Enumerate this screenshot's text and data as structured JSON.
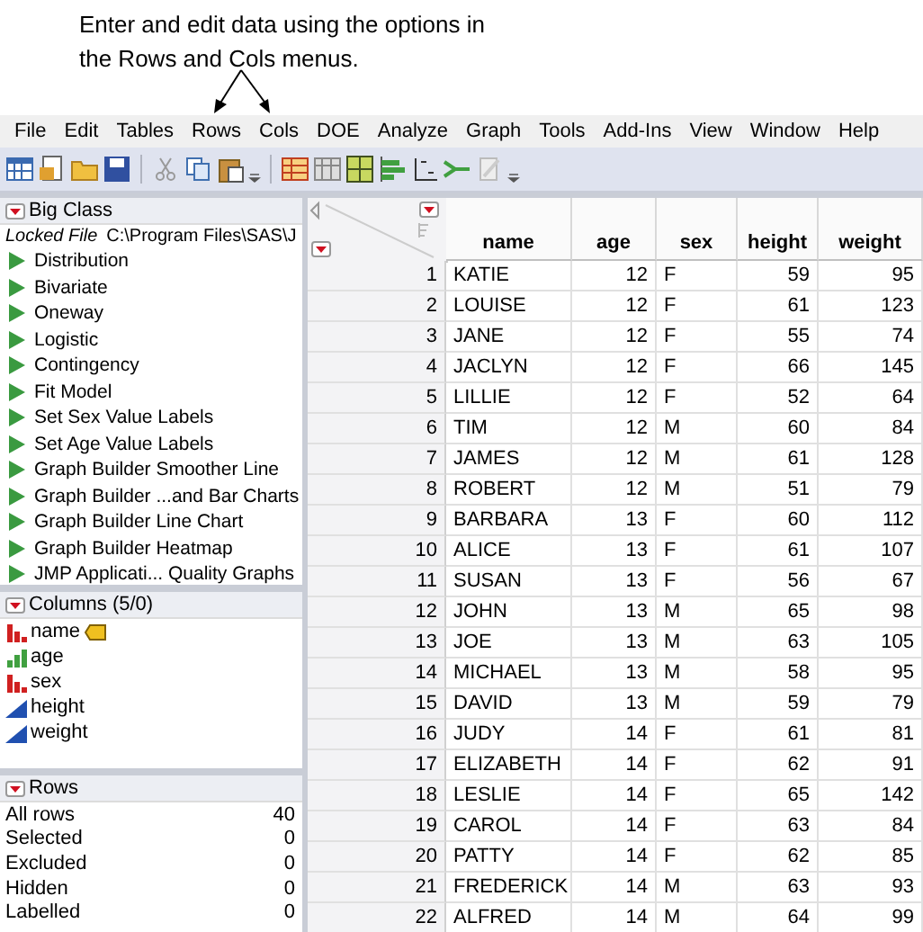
{
  "annotation": "Enter and edit data using the options in the Rows and Cols menus.",
  "menu": [
    "File",
    "Edit",
    "Tables",
    "Rows",
    "Cols",
    "DOE",
    "Analyze",
    "Graph",
    "Tools",
    "Add-Ins",
    "View",
    "Window",
    "Help"
  ],
  "table_panel": {
    "title": "Big Class",
    "locked_label": "Locked File",
    "path": "C:\\Program Files\\SAS\\J",
    "scripts": [
      "Distribution",
      "Bivariate",
      "Oneway",
      "Logistic",
      "Contingency",
      "Fit Model",
      "Set Sex Value Labels",
      "Set Age Value Labels",
      "Graph Builder Smoother Line",
      "Graph Builder ...and Bar Charts",
      "Graph Builder Line Chart",
      "Graph Builder Heatmap",
      "JMP Applicati... Quality Graphs"
    ]
  },
  "columns_panel": {
    "title": "Columns (5/0)",
    "columns": [
      {
        "name": "name",
        "kind": "nominal",
        "label": true
      },
      {
        "name": "age",
        "kind": "ordinal",
        "label": false
      },
      {
        "name": "sex",
        "kind": "nominal",
        "label": false
      },
      {
        "name": "height",
        "kind": "continuous",
        "label": false
      },
      {
        "name": "weight",
        "kind": "continuous",
        "label": false
      }
    ]
  },
  "rows_panel": {
    "title": "Rows",
    "stats": [
      {
        "label": "All rows",
        "value": "40"
      },
      {
        "label": "Selected",
        "value": "0"
      },
      {
        "label": "Excluded",
        "value": "0"
      },
      {
        "label": "Hidden",
        "value": "0"
      },
      {
        "label": "Labelled",
        "value": "0"
      }
    ]
  },
  "table": {
    "columns": [
      "",
      "name",
      "age",
      "sex",
      "height",
      "weight"
    ],
    "rows": [
      [
        "1",
        "KATIE",
        "12",
        "F",
        "59",
        "95"
      ],
      [
        "2",
        "LOUISE",
        "12",
        "F",
        "61",
        "123"
      ],
      [
        "3",
        "JANE",
        "12",
        "F",
        "55",
        "74"
      ],
      [
        "4",
        "JACLYN",
        "12",
        "F",
        "66",
        "145"
      ],
      [
        "5",
        "LILLIE",
        "12",
        "F",
        "52",
        "64"
      ],
      [
        "6",
        "TIM",
        "12",
        "M",
        "60",
        "84"
      ],
      [
        "7",
        "JAMES",
        "12",
        "M",
        "61",
        "128"
      ],
      [
        "8",
        "ROBERT",
        "12",
        "M",
        "51",
        "79"
      ],
      [
        "9",
        "BARBARA",
        "13",
        "F",
        "60",
        "112"
      ],
      [
        "10",
        "ALICE",
        "13",
        "F",
        "61",
        "107"
      ],
      [
        "11",
        "SUSAN",
        "13",
        "F",
        "56",
        "67"
      ],
      [
        "12",
        "JOHN",
        "13",
        "M",
        "65",
        "98"
      ],
      [
        "13",
        "JOE",
        "13",
        "M",
        "63",
        "105"
      ],
      [
        "14",
        "MICHAEL",
        "13",
        "M",
        "58",
        "95"
      ],
      [
        "15",
        "DAVID",
        "13",
        "M",
        "59",
        "79"
      ],
      [
        "16",
        "JUDY",
        "14",
        "F",
        "61",
        "81"
      ],
      [
        "17",
        "ELIZABETH",
        "14",
        "F",
        "62",
        "91"
      ],
      [
        "18",
        "LESLIE",
        "14",
        "F",
        "65",
        "142"
      ],
      [
        "19",
        "CAROL",
        "14",
        "F",
        "63",
        "84"
      ],
      [
        "20",
        "PATTY",
        "14",
        "F",
        "62",
        "85"
      ],
      [
        "21",
        "FREDERICK",
        "14",
        "M",
        "63",
        "93"
      ],
      [
        "22",
        "ALFRED",
        "14",
        "M",
        "64",
        "99"
      ]
    ]
  }
}
